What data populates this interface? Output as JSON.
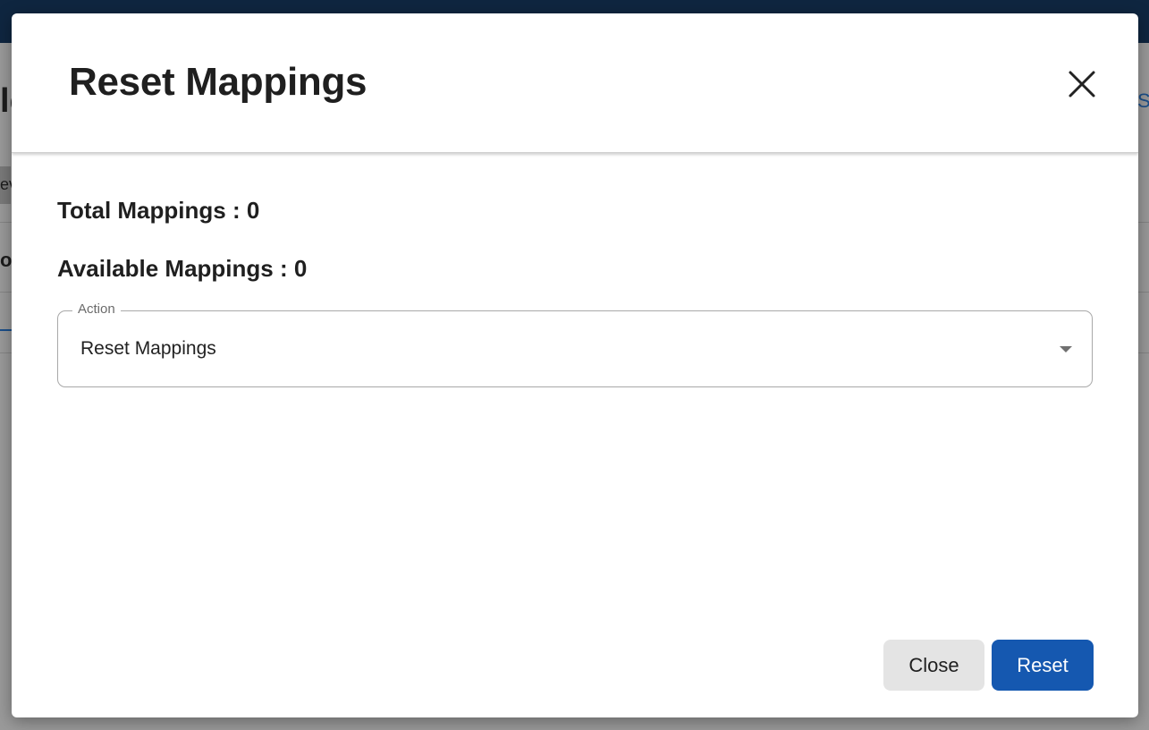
{
  "background": {
    "title_fragment": "lo",
    "link_fragment": "S",
    "chip_fragment": "ev",
    "subheading_fragment": "or"
  },
  "modal": {
    "title": "Reset Mappings",
    "close_icon": "close-icon",
    "total_mappings": "Total Mappings : 0",
    "available_mappings": "Available Mappings : 0",
    "action": {
      "label": "Action",
      "value": "Reset Mappings",
      "caret_icon": "caret-down-icon"
    },
    "buttons": {
      "close_label": "Close",
      "reset_label": "Reset"
    }
  },
  "colors": {
    "primary": "#1558b0",
    "topbar": "#0f2640",
    "secondary_button": "#e4e4e4"
  }
}
